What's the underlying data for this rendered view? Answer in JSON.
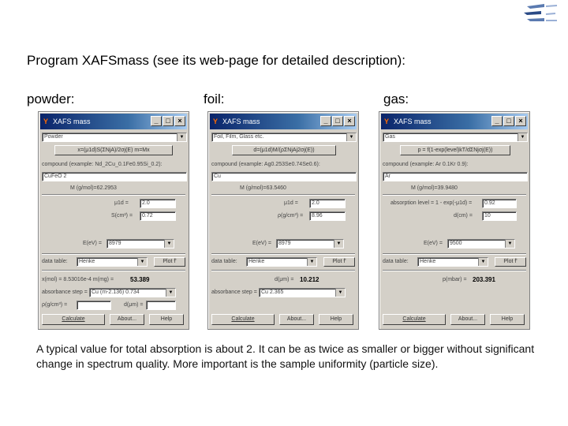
{
  "heading": "Program XAFSmass (see its web-page for detailed description):",
  "labels": {
    "powder": "powder:",
    "foil": "foil:",
    "gas": "gas:"
  },
  "window_title": "XAFS mass",
  "title_icon": "Y",
  "buttons": {
    "calculate": "Calculate",
    "about": "About...",
    "help": "Help"
  },
  "data_table_label": "data table:",
  "data_table_value": "Henke",
  "plot_label": "Plot f'",
  "e_label": "E(eV) =",
  "compound_powder_foil": "compound (example: Nd_2Cu_0.1Fe0.95Si_0.2):",
  "compound_foil": "compound (example: Ag0.253Se0.74Se0.6):",
  "compound_gas": "compound (example: Ar 0.1Kr 0.9):",
  "powder": {
    "sample_type": "Powder",
    "formula_button": "x=(μ1d)S(ΣNjA)/2σj(E)    m=Mx",
    "compound": "CuFeO 2",
    "molar_mass": "M (g/mol)=62.2953",
    "mu_d_label": "μ1d =",
    "mu_d_value": "2.0",
    "area_label": "S(cm²) =",
    "area_value": "0.72",
    "energy": "8979",
    "result_label": "x(mol) = 8.53016e-4   m(mg) =",
    "result_value": "53.389",
    "absorbance_label": "absorbance step =",
    "absorbance_value": "Cu (m-2.136) 0.734",
    "rho_label": "ρ(g/cm³) =",
    "d_label": "d(μm) ="
  },
  "foil": {
    "sample_type": "Foil, Film, Glass etc.",
    "formula_button": "d=(μ1d)M/(ρΣNjAj2σj(E))",
    "compound": "Cu",
    "molar_mass": "M (g/mol)=63.5460",
    "mu_d_label": "μ1d =",
    "mu_d_value": "2.0",
    "rho_label": "ρ(g/cm³) =",
    "rho_value": "8.96",
    "energy": "8979",
    "result_label": "d(μm) =",
    "result_value": "10.212",
    "absorbance_label": "absorbance step =",
    "absorbance_value": "Cu 2.365"
  },
  "gas": {
    "sample_type": "Gas",
    "formula_button": "p = f(1-exp(level)kT/dΣNjσj(E))",
    "compound": "Ar",
    "molar_mass": "M (g/mol)=39.9480",
    "level_label": "absorption level = 1 - exp(-μ1d) =",
    "level_value": "0.92",
    "d_label": "d(cm) =",
    "d_value": "10",
    "energy": "9500",
    "result_label": "p(mbar) =",
    "result_value": "203.391"
  },
  "note": "A typical value for total absorption is about 2. It can be as twice as smaller or bigger without significant change in spectrum quality. More important is the sample uniformity (particle size)."
}
